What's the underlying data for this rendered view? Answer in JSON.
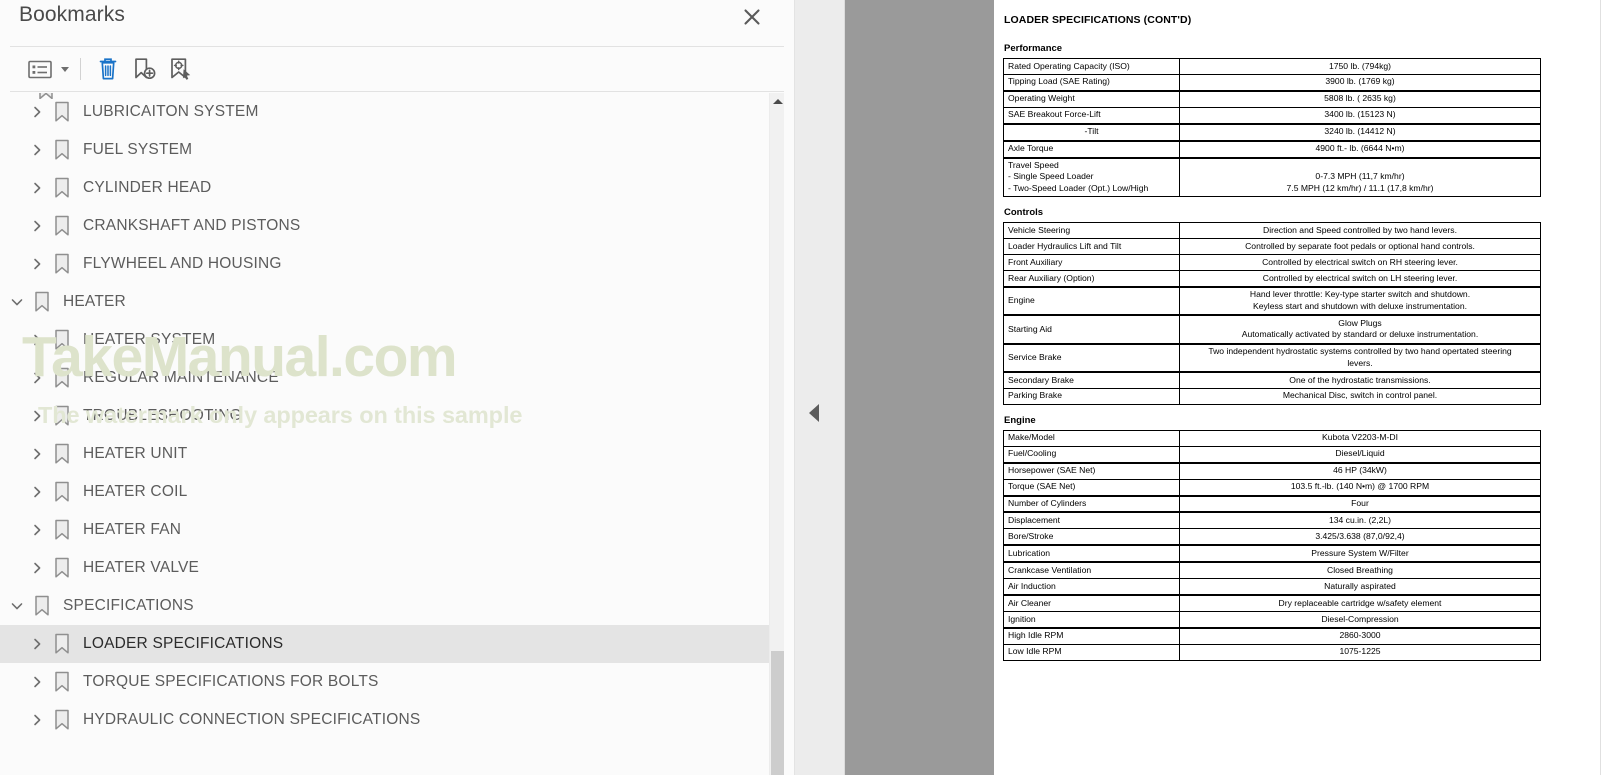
{
  "panel": {
    "title": "Bookmarks",
    "close_label": "Close",
    "toolbar": {
      "view_options_label": "View options",
      "view_options_caret_label": "Show view options menu",
      "delete_label": "Delete bookmark",
      "new_bookmark_label": "New bookmark",
      "set_destination_label": "Set bookmark destination"
    },
    "scrollbar": {
      "up_label": "Scroll up"
    }
  },
  "watermark": {
    "main": "TakeManual.com",
    "sub": "The watermark only appears on this sample"
  },
  "splitter": {
    "collapse_label": "Collapse panel"
  },
  "bookmarks": [
    {
      "label": "LUBRICAITON SYSTEM",
      "level": 1,
      "expanded": false,
      "selected": false
    },
    {
      "label": "FUEL SYSTEM",
      "level": 1,
      "expanded": false,
      "selected": false
    },
    {
      "label": "CYLINDER HEAD",
      "level": 1,
      "expanded": false,
      "selected": false
    },
    {
      "label": "CRANKSHAFT AND PISTONS",
      "level": 1,
      "expanded": false,
      "selected": false
    },
    {
      "label": "FLYWHEEL AND HOUSING",
      "level": 1,
      "expanded": false,
      "selected": false
    },
    {
      "label": "HEATER",
      "level": 0,
      "expanded": true,
      "selected": false
    },
    {
      "label": "HEATER SYSTEM",
      "level": 1,
      "expanded": false,
      "selected": false
    },
    {
      "label": "REGULAR MAINTENANCE",
      "level": 1,
      "expanded": false,
      "selected": false
    },
    {
      "label": "TROUBLESHOOTING",
      "level": 1,
      "expanded": false,
      "selected": false
    },
    {
      "label": "HEATER UNIT",
      "level": 1,
      "expanded": false,
      "selected": false
    },
    {
      "label": "HEATER COIL",
      "level": 1,
      "expanded": false,
      "selected": false
    },
    {
      "label": "HEATER FAN",
      "level": 1,
      "expanded": false,
      "selected": false
    },
    {
      "label": "HEATER VALVE",
      "level": 1,
      "expanded": false,
      "selected": false
    },
    {
      "label": "SPECIFICATIONS",
      "level": 0,
      "expanded": true,
      "selected": false
    },
    {
      "label": "LOADER SPECIFICATIONS",
      "level": 1,
      "expanded": false,
      "selected": true
    },
    {
      "label": "TORQUE SPECIFICATIONS FOR BOLTS",
      "level": 1,
      "expanded": false,
      "selected": false
    },
    {
      "label": "HYDRAULIC CONNECTION SPECIFICATIONS",
      "level": 1,
      "expanded": false,
      "selected": false
    }
  ],
  "document": {
    "title": "LOADER SPECIFICATIONS (CONT'D)",
    "sections": [
      {
        "heading": "Performance",
        "rows": [
          {
            "key": "Rated Operating Capacity (ISO)",
            "value": "1750 lb. (794kg)",
            "thick_top": false,
            "key_center": false
          },
          {
            "key": "Tipping Load (SAE Rating)",
            "value": "3900 lb. (1769 kg)",
            "thick_top": false,
            "key_center": false
          },
          {
            "key": "Operating Weight",
            "value": "5808 lb. ( 2635 kg)",
            "thick_top": true,
            "key_center": false
          },
          {
            "key": "SAE Breakout Force-Lift",
            "value": "3400 lb. (15123 N)",
            "thick_top": false,
            "key_center": false
          },
          {
            "key": "-Tilt",
            "value": "3240 lb. (14412 N)",
            "thick_top": true,
            "key_center": true
          },
          {
            "key": "Axle Torque",
            "value": "4900 ft.- lb. (6644 N•m)",
            "thick_top": true,
            "key_center": false
          },
          {
            "key": "Travel Speed\n  - Single Speed Loader\n  - Two-Speed Loader (Opt.) Low/High",
            "value": "\n0-7.3 MPH (11,7 km/hr)\n7.5 MPH (12 km/hr) / 11.1 (17,8 km/hr)",
            "thick_top": true,
            "key_center": false
          }
        ]
      },
      {
        "heading": "Controls",
        "rows": [
          {
            "key": "Vehicle Steering",
            "value": "Direction and Speed controlled by two hand levers.",
            "thick_top": false,
            "key_center": false
          },
          {
            "key": "Loader Hydraulics Lift and Tilt",
            "value": "Controlled by separate foot pedals or optional hand controls.",
            "thick_top": false,
            "key_center": false
          },
          {
            "key": "Front Auxiliary",
            "value": "Controlled by electrical switch on RH steering lever.",
            "thick_top": false,
            "key_center": false
          },
          {
            "key": "Rear Auxiliary (Option)",
            "value": "Controlled by electrical switch on LH steering lever.",
            "thick_top": false,
            "key_center": false
          },
          {
            "key": "Engine",
            "value": "Hand lever throttle: Key-type starter switch and shutdown.\nKeyless start and shutdown with deluxe instrumentation.",
            "thick_top": true,
            "key_center": false
          },
          {
            "key": "Starting Aid",
            "value": "Glow Plugs\nAutomatically activated by standard or deluxe instrumentation.",
            "thick_top": true,
            "key_center": false
          },
          {
            "key": "Service Brake",
            "value": "Two independent hydrostatic systems controlled by two hand opertated steering\nlevers.",
            "thick_top": true,
            "key_center": false
          },
          {
            "key": "Secondary Brake",
            "value": "One of the hydrostatic transmissions.",
            "thick_top": true,
            "key_center": false
          },
          {
            "key": "Parking Brake",
            "value": "Mechanical Disc, switch in control panel.",
            "thick_top": false,
            "key_center": false
          }
        ]
      },
      {
        "heading": "Engine",
        "rows": [
          {
            "key": "Make/Model",
            "value": "Kubota V2203-M-DI",
            "thick_top": false,
            "key_center": false
          },
          {
            "key": "Fuel/Cooling",
            "value": "Diesel/Liquid",
            "thick_top": false,
            "key_center": false
          },
          {
            "key": "Horsepower (SAE Net)",
            "value": "46 HP (34kW)",
            "thick_top": true,
            "key_center": false
          },
          {
            "key": "Torque (SAE Net)",
            "value": "103.5 ft.-lb. (140 N•m) @ 1700 RPM",
            "thick_top": false,
            "key_center": false
          },
          {
            "key": "Number of Cylinders",
            "value": "Four",
            "thick_top": true,
            "key_center": false
          },
          {
            "key": "Displacement",
            "value": "134 cu.in. (2,2L)",
            "thick_top": true,
            "key_center": false
          },
          {
            "key": "Bore/Stroke",
            "value": "3.425/3.638 (87,0/92,4)",
            "thick_top": false,
            "key_center": false
          },
          {
            "key": "Lubrication",
            "value": "Pressure System W/Filter",
            "thick_top": true,
            "key_center": false
          },
          {
            "key": "Crankcase Ventilation",
            "value": "Closed Breathing",
            "thick_top": true,
            "key_center": false
          },
          {
            "key": "Air Induction",
            "value": "Naturally aspirated",
            "thick_top": false,
            "key_center": false
          },
          {
            "key": "Air Cleaner",
            "value": "Dry replaceable cartridge w/safety element",
            "thick_top": true,
            "key_center": false
          },
          {
            "key": "Ignition",
            "value": "Diesel-Compression",
            "thick_top": false,
            "key_center": false
          },
          {
            "key": "High Idle RPM",
            "value": "2860-3000",
            "thick_top": true,
            "key_center": false
          },
          {
            "key": "Low Idle RPM",
            "value": "1075-1225",
            "thick_top": false,
            "key_center": false
          }
        ]
      }
    ]
  },
  "colors": {
    "accent": "#1a73c8",
    "selection": "#e4e4e4",
    "watermark": "#dde3cb",
    "gutter": "#9a9a9a",
    "text": "#5c5c5c"
  }
}
